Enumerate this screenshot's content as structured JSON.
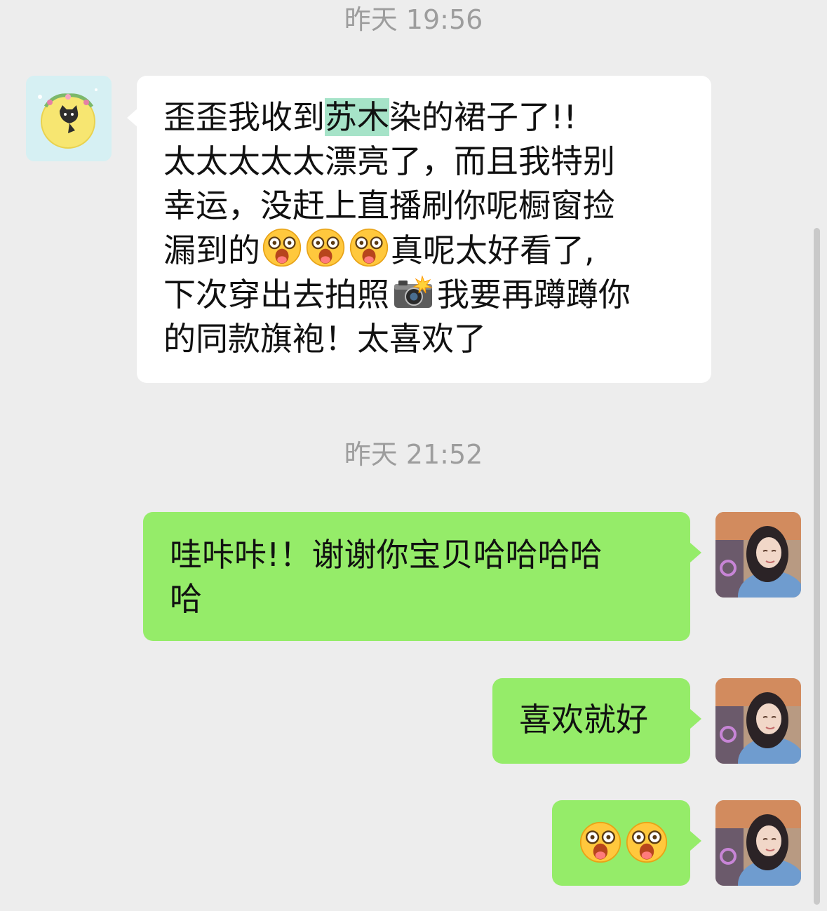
{
  "timestamps": [
    "昨天 19:56",
    "昨天 21:52"
  ],
  "messages": {
    "incoming": {
      "lines": {
        "l1_pre": "歪歪我收到",
        "l1_hl": "苏木",
        "l1_post": "染的裙子了!!",
        "l2": "太太太太太漂亮了，而且我特别",
        "l3": "幸运，没赶上直播刷你呢橱窗捡",
        "l4_pre": "漏到的",
        "l4_post": "真呢太好看了,",
        "l5_pre": "下次穿出去拍照",
        "l5_post": "我要再蹲蹲你",
        "l6": "的同款旗袍！太喜欢了"
      },
      "emoji": "astonished-face-emoji",
      "camera_icon": "camera-flash-emoji"
    },
    "outgoing": [
      {
        "lines": [
          "哇咔咔!！谢谢你宝贝哈哈哈哈",
          "哈"
        ]
      },
      {
        "lines": [
          "喜欢就好"
        ]
      },
      {
        "emoji_count": 2,
        "emoji": "astonished-face-emoji"
      }
    ]
  },
  "colors": {
    "background": "#ededed",
    "incoming_bubble": "#ffffff",
    "outgoing_bubble": "#95ec69",
    "highlight": "#a6e3c8",
    "timestamp_text": "#9d9d9d"
  }
}
